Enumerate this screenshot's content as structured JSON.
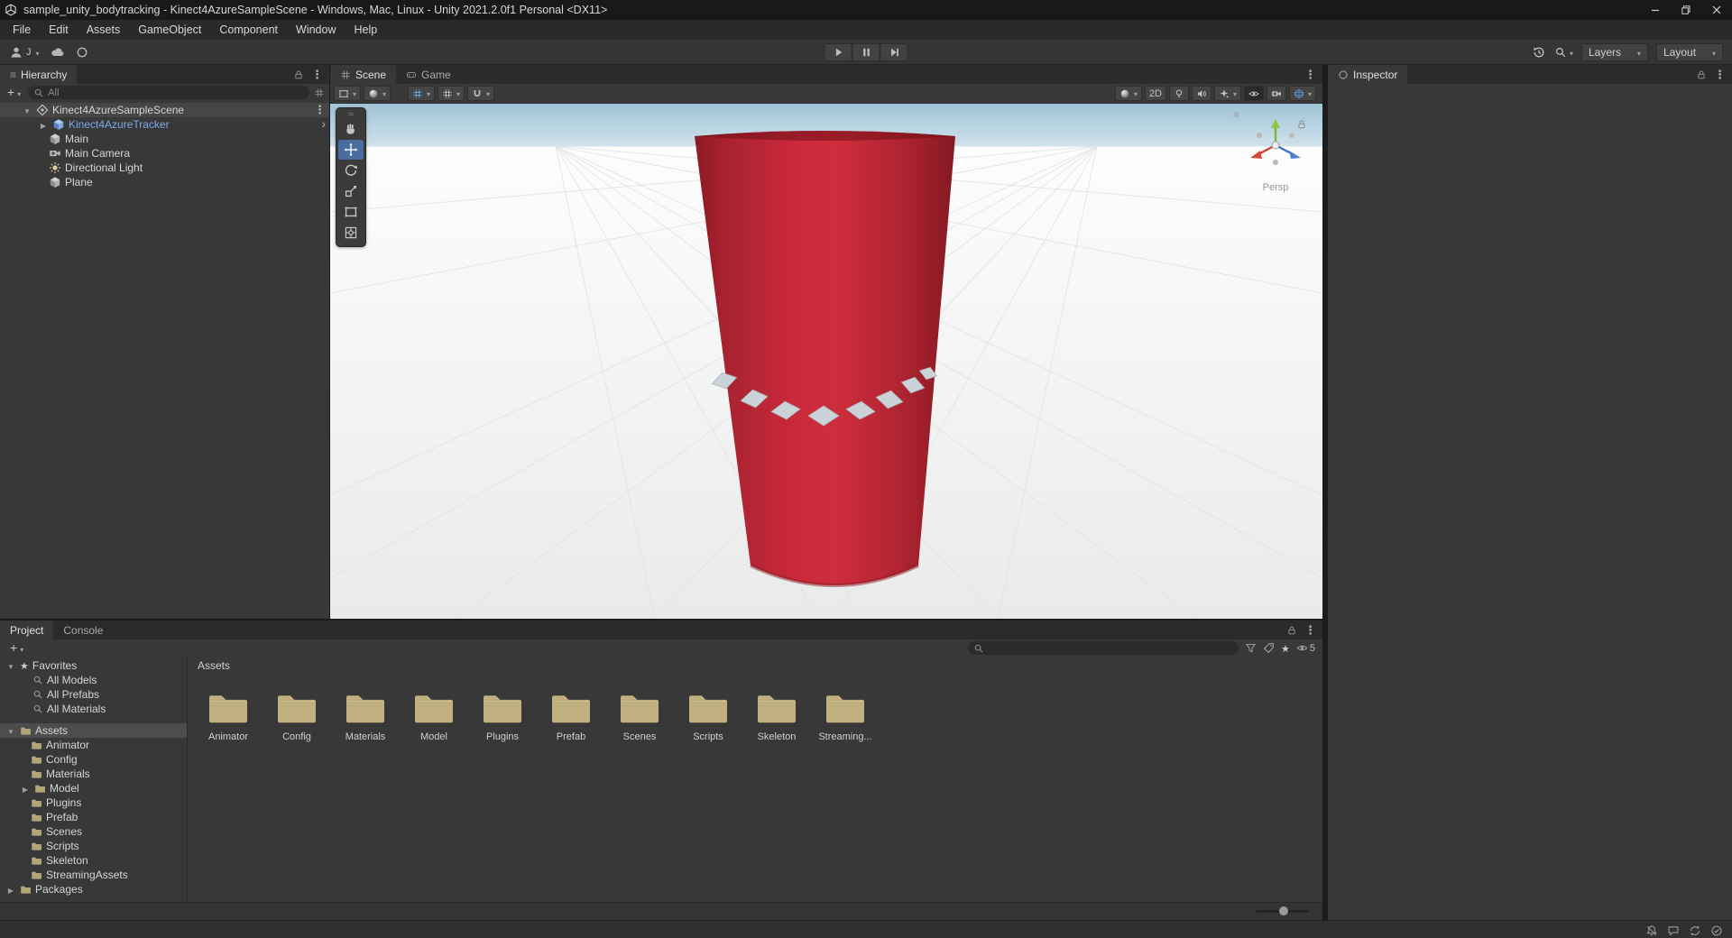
{
  "title_bar": {
    "title": "sample_unity_bodytracking - Kinect4AzureSampleScene - Windows, Mac, Linux - Unity 2021.2.0f1 Personal <DX11>"
  },
  "menu_bar": {
    "items": [
      "File",
      "Edit",
      "Assets",
      "GameObject",
      "Component",
      "Window",
      "Help"
    ]
  },
  "toolbar": {
    "account_initial": "J",
    "layers": "Layers",
    "layout": "Layout"
  },
  "hierarchy": {
    "tab": "Hierarchy",
    "search_text": "All",
    "scene_name": "Kinect4AzureSampleScene",
    "items": [
      {
        "label": "Kinect4AzureTracker"
      },
      {
        "label": "Main"
      },
      {
        "label": "Main Camera"
      },
      {
        "label": "Directional Light"
      },
      {
        "label": "Plane"
      }
    ]
  },
  "scene": {
    "tab_scene": "Scene",
    "tab_game": "Game",
    "mode_2d": "2D",
    "gizmo_label": "Persp"
  },
  "inspector": {
    "tab": "Inspector"
  },
  "project": {
    "tab_project": "Project",
    "tab_console": "Console",
    "hidden_count": "5",
    "favorites_label": "Favorites",
    "favorites": [
      "All Models",
      "All Prefabs",
      "All Materials"
    ],
    "assets_label": "Assets",
    "folders": [
      "Animator",
      "Config",
      "Materials",
      "Model",
      "Plugins",
      "Prefab",
      "Scenes",
      "Scripts",
      "Skeleton",
      "StreamingAssets"
    ],
    "packages_label": "Packages",
    "breadcrumb": "Assets",
    "grid_folders": [
      "Animator",
      "Config",
      "Materials",
      "Model",
      "Plugins",
      "Prefab",
      "Scenes",
      "Scripts",
      "Skeleton",
      "Streaming..."
    ]
  },
  "colors": {
    "selection_blue": "#4a6da0",
    "prefab_text_blue": "#7fa7e8",
    "cylinder_red": "#c9293a",
    "folder_tan": "#c0b080",
    "gizmo_active_blue": "#55a3e8"
  }
}
